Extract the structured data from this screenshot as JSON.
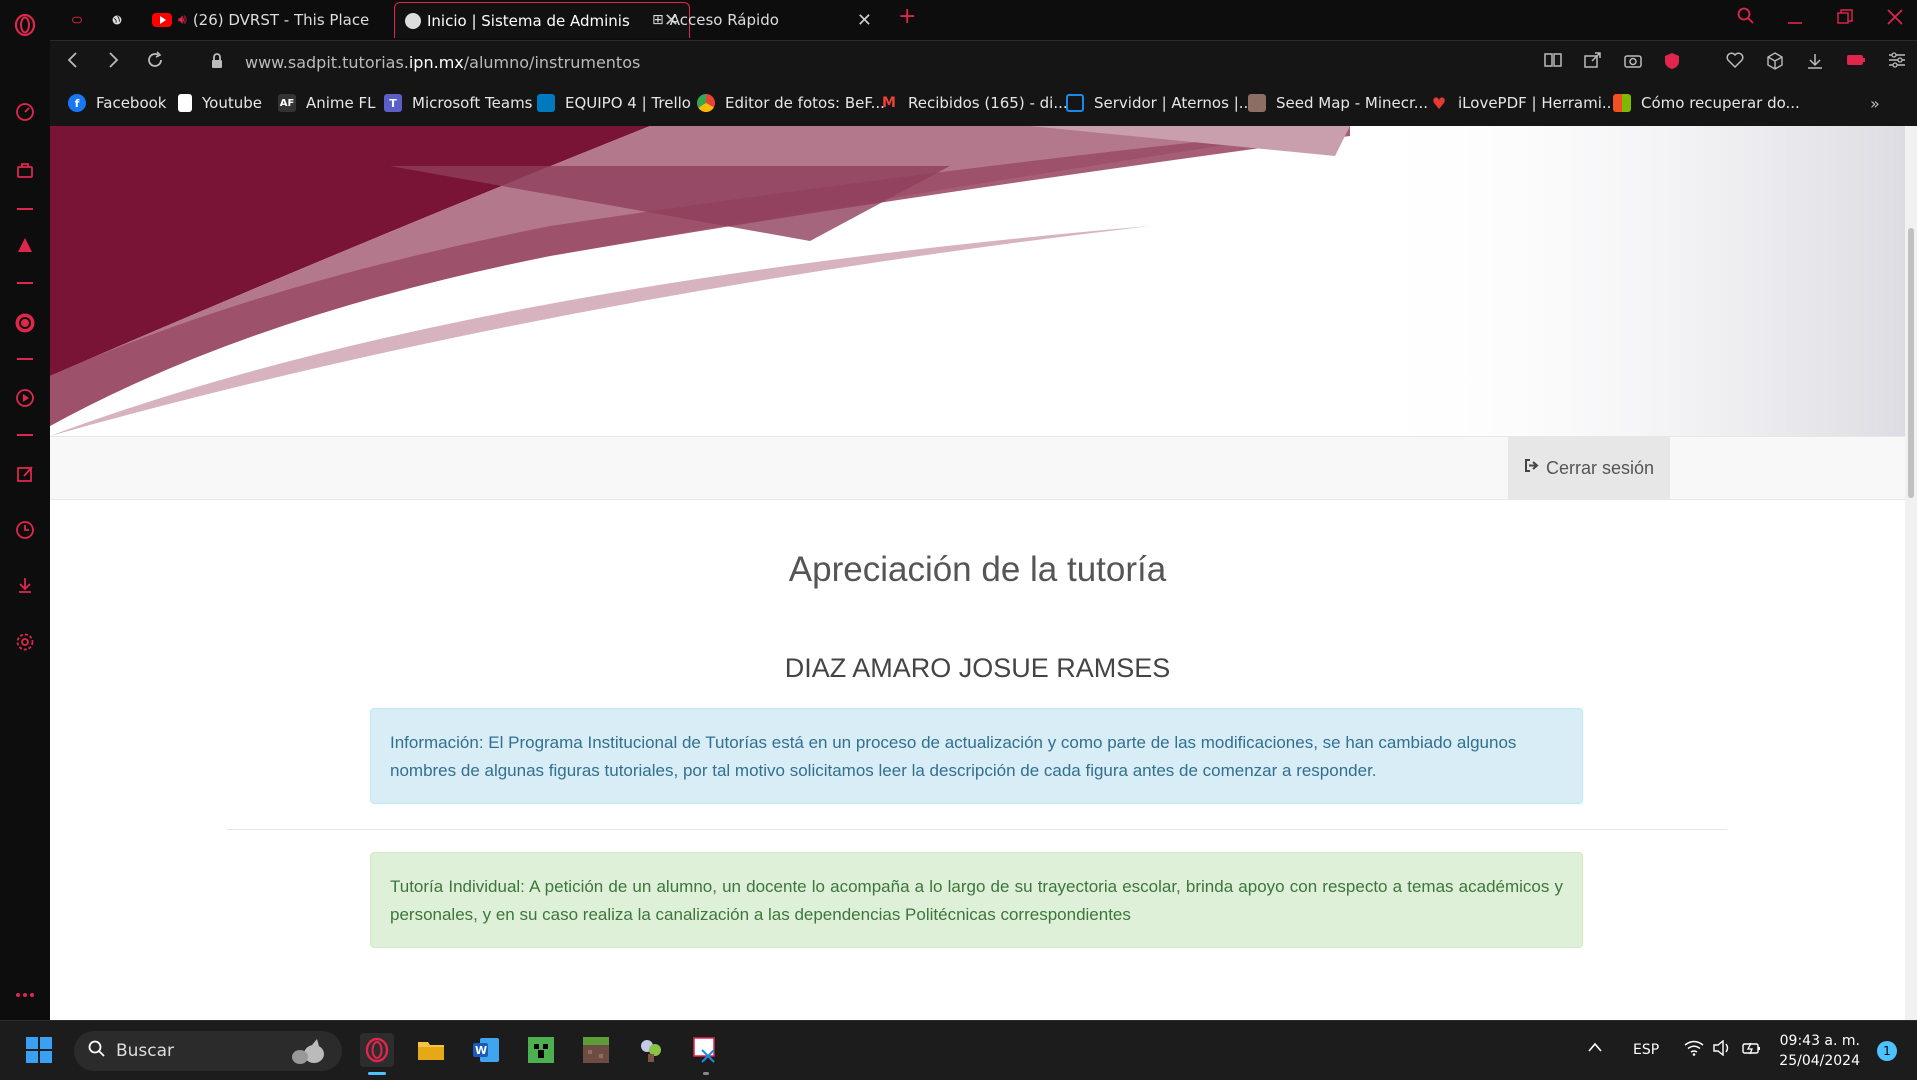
{
  "browser": {
    "tabs": [
      {
        "label": "(26) DVRST - This Place"
      },
      {
        "label": "Inicio | Sistema de Adminis"
      },
      {
        "label": "Acceso Rápido"
      }
    ],
    "url_prefix": "www.sadpit.tutorias.",
    "url_domain": "ipn.mx",
    "url_path": "/alumno/instrumentos",
    "bookmarks": [
      {
        "label": "Facebook",
        "icon": "facebook-icon",
        "color": "#1877f2"
      },
      {
        "label": "Youtube",
        "icon": "file-icon",
        "color": "#ffffff"
      },
      {
        "label": "Anime FL",
        "icon": "animefl-icon",
        "color": "#333333"
      },
      {
        "label": "Microsoft Teams",
        "icon": "teams-icon",
        "color": "#5b5fc7"
      },
      {
        "label": "EQUIPO 4 | Trello",
        "icon": "trello-icon",
        "color": "#0079bf"
      },
      {
        "label": "Editor de fotos: BeF...",
        "icon": "chrome-icon",
        "color": "#4caf50"
      },
      {
        "label": "Recibidos (165) - di...",
        "icon": "gmail-icon",
        "color": "#ea4335"
      },
      {
        "label": "Servidor | Aternos |...",
        "icon": "aternos-icon",
        "color": "#1e88e5"
      },
      {
        "label": "Seed Map - Minecr...",
        "icon": "seedmap-icon",
        "color": "#8d6e63"
      },
      {
        "label": "iLovePDF | Herrami...",
        "icon": "ilovepdf-icon",
        "color": "#e53935"
      },
      {
        "label": "Cómo recuperar do...",
        "icon": "microsoft-icon",
        "color": "#f25022"
      }
    ]
  },
  "page": {
    "logout_label": "Cerrar sesión",
    "title": "Apreciación de la tutoría",
    "student_name": "DIAZ AMARO JOSUE RAMSES",
    "info_label": "Información:",
    "info_text": " El Programa Institucional de Tutorías está en un proceso de actualización y como parte de las modificaciones, se han cambiado algunos nombres de algunas figuras tutoriales, por tal motivo solicitamos leer la descripción de cada figura antes de comenzar a responder.",
    "tutoria_label": "Tutoría Individual:",
    "tutoria_text": " A petición de un alumno, un docente lo acompaña a lo largo de su trayectoria escolar, brinda apoyo con respecto a temas académicos y personales, y en su caso realiza la canalización a las dependencias Politécnicas correspondientes"
  },
  "taskbar": {
    "search_placeholder": "Buscar",
    "language": "ESP",
    "time": "09:43 a. m.",
    "date": "25/04/2024",
    "notifications": "1"
  },
  "colors": {
    "opera_accent": "#e0264d",
    "banner_maroon": "#7a1436",
    "info_bg": "#d9edf7",
    "success_bg": "#dff0d8"
  }
}
